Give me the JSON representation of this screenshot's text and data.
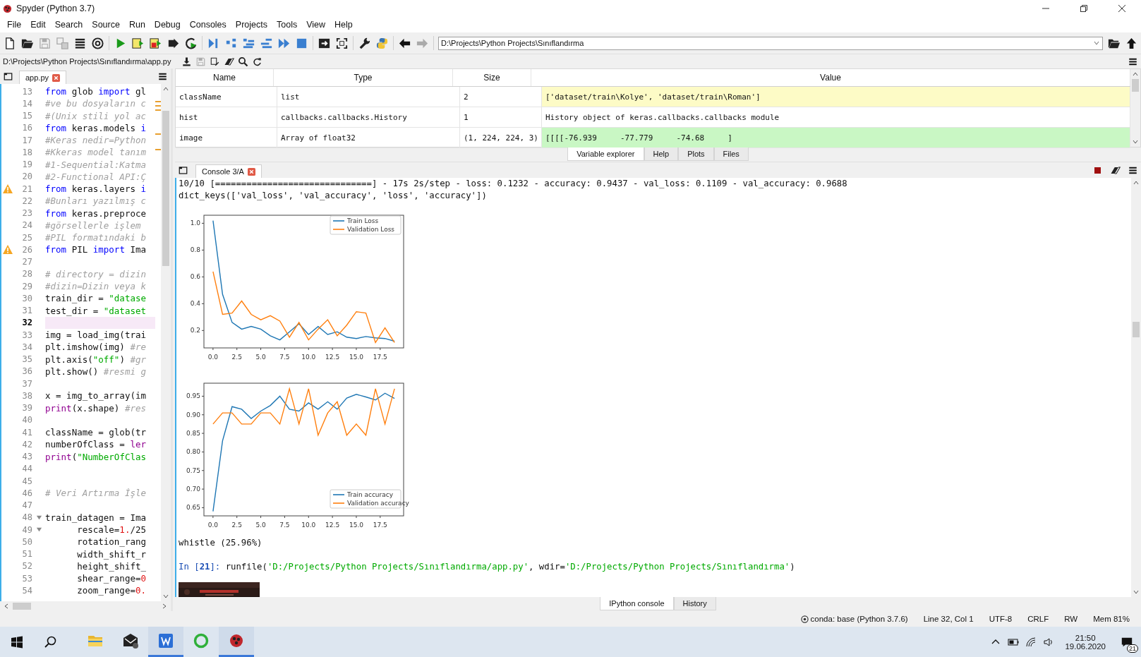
{
  "window": {
    "title": "Spyder (Python 3.7)"
  },
  "menu": [
    {
      "label": "File"
    },
    {
      "label": "Edit"
    },
    {
      "label": "Search"
    },
    {
      "label": "Source"
    },
    {
      "label": "Run"
    },
    {
      "label": "Debug"
    },
    {
      "label": "Consoles"
    },
    {
      "label": "Projects"
    },
    {
      "label": "Tools"
    },
    {
      "label": "View"
    },
    {
      "label": "Help"
    }
  ],
  "toolbar": {
    "path": "D:\\Projects\\Python Projects\\Sınıflandırma"
  },
  "editor": {
    "file_path": "D:\\Projects\\Python Projects\\Sınıflandırma\\app.py",
    "tabs": [
      {
        "label": "app.py",
        "selected": true
      }
    ],
    "lines": [
      {
        "number": "13",
        "kind": "code",
        "current": false,
        "segs": [
          {
            "kind": "kw",
            "text": "from"
          },
          {
            "kind": "plain",
            "text": " glob "
          },
          {
            "kind": "kw",
            "text": "import"
          },
          {
            "kind": "plain",
            "text": " gl"
          }
        ]
      },
      {
        "number": "14",
        "kind": "code",
        "current": false,
        "segs": [
          {
            "kind": "com",
            "text": "#ve bu dosyaların c"
          }
        ]
      },
      {
        "number": "15",
        "kind": "code",
        "current": false,
        "segs": [
          {
            "kind": "com",
            "text": "#(Unix stili yol ac"
          }
        ]
      },
      {
        "number": "16",
        "kind": "code",
        "current": false,
        "segs": [
          {
            "kind": "kw",
            "text": "from"
          },
          {
            "kind": "plain",
            "text": " keras.models "
          },
          {
            "kind": "kw",
            "text": "i"
          }
        ]
      },
      {
        "number": "17",
        "kind": "code",
        "current": false,
        "segs": [
          {
            "kind": "com",
            "text": "#Keras nedir=Python"
          }
        ]
      },
      {
        "number": "18",
        "kind": "code",
        "current": false,
        "segs": [
          {
            "kind": "com",
            "text": "#Kkeras model tanım"
          }
        ]
      },
      {
        "number": "19",
        "kind": "code",
        "current": false,
        "segs": [
          {
            "kind": "com",
            "text": "#1-Sequential:Katma"
          }
        ]
      },
      {
        "number": "20",
        "kind": "code",
        "current": false,
        "segs": [
          {
            "kind": "com",
            "text": "#2-Functional API:Ç"
          }
        ]
      },
      {
        "number": "21",
        "kind": "warning",
        "current": false,
        "segs": [
          {
            "kind": "kw",
            "text": "from"
          },
          {
            "kind": "plain",
            "text": " keras.layers "
          },
          {
            "kind": "kw",
            "text": "i"
          }
        ]
      },
      {
        "number": "22",
        "kind": "code",
        "current": false,
        "segs": [
          {
            "kind": "com",
            "text": "#Bunları yazılmış c"
          }
        ]
      },
      {
        "number": "23",
        "kind": "code",
        "current": false,
        "segs": [
          {
            "kind": "kw",
            "text": "from"
          },
          {
            "kind": "plain",
            "text": " keras.preproce"
          }
        ]
      },
      {
        "number": "24",
        "kind": "code",
        "current": false,
        "segs": [
          {
            "kind": "com",
            "text": "#görsellerle işlem"
          }
        ]
      },
      {
        "number": "25",
        "kind": "code",
        "current": false,
        "segs": [
          {
            "kind": "com",
            "text": "#PIL formatındaki b"
          }
        ]
      },
      {
        "number": "26",
        "kind": "warning",
        "current": false,
        "segs": [
          {
            "kind": "kw",
            "text": "from"
          },
          {
            "kind": "plain",
            "text": " PIL "
          },
          {
            "kind": "kw",
            "text": "import"
          },
          {
            "kind": "plain",
            "text": " Ima"
          }
        ]
      },
      {
        "number": "27",
        "kind": "code",
        "current": false
      },
      {
        "number": "28",
        "kind": "code",
        "current": false,
        "segs": [
          {
            "kind": "com",
            "text": "# directory = dizin"
          }
        ]
      },
      {
        "number": "29",
        "kind": "code",
        "current": false,
        "segs": [
          {
            "kind": "com",
            "text": "#dizin=Dizin veya k"
          }
        ]
      },
      {
        "number": "30",
        "kind": "code",
        "current": false,
        "segs": [
          {
            "kind": "plain",
            "text": "train_dir = "
          },
          {
            "kind": "str",
            "text": "\"datase"
          }
        ]
      },
      {
        "number": "31",
        "kind": "code",
        "current": false,
        "segs": [
          {
            "kind": "plain",
            "text": "test_dir = "
          },
          {
            "kind": "str",
            "text": "\"dataset"
          }
        ]
      },
      {
        "number": "32",
        "kind": "code",
        "current": true
      },
      {
        "number": "33",
        "kind": "code",
        "current": false,
        "segs": [
          {
            "kind": "plain",
            "text": "img = load_img(trai"
          }
        ]
      },
      {
        "number": "34",
        "kind": "code",
        "current": false,
        "segs": [
          {
            "kind": "plain",
            "text": "plt.imshow(img) "
          },
          {
            "kind": "com",
            "text": "#re"
          }
        ]
      },
      {
        "number": "35",
        "kind": "code",
        "current": false,
        "segs": [
          {
            "kind": "plain",
            "text": "plt.axis("
          },
          {
            "kind": "str",
            "text": "\"off\""
          },
          {
            "kind": "plain",
            "text": ") "
          },
          {
            "kind": "com",
            "text": "#gr"
          }
        ]
      },
      {
        "number": "36",
        "kind": "code",
        "current": false,
        "segs": [
          {
            "kind": "plain",
            "text": "plt.show() "
          },
          {
            "kind": "com",
            "text": "#resmi g"
          }
        ]
      },
      {
        "number": "37",
        "kind": "code",
        "current": false
      },
      {
        "number": "38",
        "kind": "code",
        "current": false,
        "segs": [
          {
            "kind": "plain",
            "text": "x = img_to_array(im"
          }
        ]
      },
      {
        "number": "39",
        "kind": "code",
        "current": false,
        "segs": [
          {
            "kind": "bi",
            "text": "print"
          },
          {
            "kind": "plain",
            "text": "(x.shape) "
          },
          {
            "kind": "com",
            "text": "#res"
          }
        ]
      },
      {
        "number": "40",
        "kind": "code",
        "current": false
      },
      {
        "number": "41",
        "kind": "code",
        "current": false,
        "segs": [
          {
            "kind": "plain",
            "text": "className = glob(tr"
          }
        ]
      },
      {
        "number": "42",
        "kind": "code",
        "current": false,
        "segs": [
          {
            "kind": "plain",
            "text": "numberOfClass = "
          },
          {
            "kind": "bi",
            "text": "ler"
          }
        ]
      },
      {
        "number": "43",
        "kind": "code",
        "current": false,
        "segs": [
          {
            "kind": "bi",
            "text": "print"
          },
          {
            "kind": "plain",
            "text": "("
          },
          {
            "kind": "str",
            "text": "\"NumberOfClas"
          }
        ]
      },
      {
        "number": "44",
        "kind": "code",
        "current": false
      },
      {
        "number": "45",
        "kind": "code",
        "current": false
      },
      {
        "number": "46",
        "kind": "code",
        "current": false,
        "segs": [
          {
            "kind": "com",
            "text": "# Veri Artırma İşle"
          }
        ]
      },
      {
        "number": "47",
        "kind": "code",
        "current": false
      },
      {
        "number": "48",
        "kind": "fold",
        "current": false,
        "segs": [
          {
            "kind": "plain",
            "text": "train_datagen = Ima"
          }
        ]
      },
      {
        "number": "49",
        "kind": "fold",
        "current": false,
        "segs": [
          {
            "kind": "plain",
            "text": "      rescale="
          },
          {
            "kind": "num",
            "text": "1."
          },
          {
            "kind": "plain",
            "text": "/25"
          }
        ]
      },
      {
        "number": "50",
        "kind": "code",
        "current": false,
        "segs": [
          {
            "kind": "plain",
            "text": "      rotation_rang"
          }
        ]
      },
      {
        "number": "51",
        "kind": "code",
        "current": false,
        "segs": [
          {
            "kind": "plain",
            "text": "      width_shift_r"
          }
        ]
      },
      {
        "number": "52",
        "kind": "code",
        "current": false,
        "segs": [
          {
            "kind": "plain",
            "text": "      height_shift_"
          }
        ]
      },
      {
        "number": "53",
        "kind": "code",
        "current": false,
        "segs": [
          {
            "kind": "plain",
            "text": "      shear_range="
          },
          {
            "kind": "num",
            "text": "0"
          }
        ]
      },
      {
        "number": "54",
        "kind": "code",
        "current": false,
        "segs": [
          {
            "kind": "plain",
            "text": "      zoom_range="
          },
          {
            "kind": "num",
            "text": "0."
          }
        ]
      }
    ]
  },
  "variable_explorer": {
    "columns": [
      "Name",
      "Type",
      "Size",
      "Value"
    ],
    "rows": [
      {
        "name": "className",
        "type": "list",
        "size": "2",
        "value": "['dataset/train\\Kolye', 'dataset/train\\Roman']",
        "color": "#fdfbc6"
      },
      {
        "name": "hist",
        "type": "callbacks.callbacks.History",
        "size": "1",
        "value": "History object of keras.callbacks.callbacks module",
        "color": "#ffffff"
      },
      {
        "name": "image",
        "type": "Array of float32",
        "size": "(1, 224, 224, 3)",
        "value": "[[[[-76.939     -77.779     -74.68     ]",
        "color": "#c9f7c4"
      }
    ],
    "tabs": [
      {
        "label": "Variable explorer",
        "selected": true
      },
      {
        "label": "Help",
        "selected": false
      },
      {
        "label": "Plots",
        "selected": false
      },
      {
        "label": "Files",
        "selected": false
      }
    ]
  },
  "console": {
    "tabs": [
      {
        "label": "Console 3/A",
        "selected": true
      }
    ],
    "outputs": [
      {
        "kind": "text",
        "text": "10/10 [==============================] - 17s 2s/step - loss: 0.1232 - accuracy: 0.9437 - val_loss: 0.1109 - val_accuracy: 0.9688"
      },
      {
        "kind": "text",
        "text": "dict_keys(['val_loss', 'val_accuracy', 'loss', 'accuracy'])"
      },
      {
        "kind": "chart",
        "chart_data": {
          "type": "line",
          "legend": "upper right",
          "x": [
            0,
            1,
            2,
            3,
            4,
            5,
            6,
            7,
            8,
            9,
            10,
            11,
            12,
            13,
            14,
            15,
            16,
            17,
            18,
            19
          ],
          "xlim": [
            -0.95,
            19.95
          ],
          "ylim": [
            0.07,
            1.06
          ],
          "xticks": [
            {
              "value": 0,
              "label": "0.0"
            },
            {
              "value": 2.5,
              "label": "2.5"
            },
            {
              "value": 5,
              "label": "5.0"
            },
            {
              "value": 7.5,
              "label": "7.5"
            },
            {
              "value": 10,
              "label": "10.0"
            },
            {
              "value": 12.5,
              "label": "12.5"
            },
            {
              "value": 15,
              "label": "15.0"
            },
            {
              "value": 17.5,
              "label": "17.5"
            }
          ],
          "yticks": [
            {
              "value": 0.2,
              "label": "0.2"
            },
            {
              "value": 0.4,
              "label": "0.4"
            },
            {
              "value": 0.6,
              "label": "0.6"
            },
            {
              "value": 0.8,
              "label": "0.8"
            },
            {
              "value": 1.0,
              "label": "1.0"
            }
          ],
          "series": [
            {
              "name": "Train Loss",
              "color": "#1f77b4",
              "values": [
                1.02,
                0.47,
                0.26,
                0.21,
                0.23,
                0.21,
                0.16,
                0.13,
                0.19,
                0.25,
                0.17,
                0.23,
                0.17,
                0.19,
                0.15,
                0.14,
                0.155,
                0.145,
                0.14,
                0.12
              ]
            },
            {
              "name": "Validation Loss",
              "color": "#ff7f0e",
              "values": [
                0.64,
                0.32,
                0.33,
                0.42,
                0.32,
                0.28,
                0.31,
                0.27,
                0.15,
                0.26,
                0.13,
                0.21,
                0.28,
                0.16,
                0.24,
                0.34,
                0.33,
                0.11,
                0.22,
                0.11
              ]
            }
          ]
        }
      },
      {
        "kind": "chart",
        "chart_data": {
          "type": "line",
          "legend": "lower right",
          "x": [
            0,
            1,
            2,
            3,
            4,
            5,
            6,
            7,
            8,
            9,
            10,
            11,
            12,
            13,
            14,
            15,
            16,
            17,
            18,
            19
          ],
          "xlim": [
            -0.95,
            19.95
          ],
          "ylim": [
            0.628,
            0.985
          ],
          "xticks": [
            {
              "value": 0,
              "label": "0.0"
            },
            {
              "value": 2.5,
              "label": "2.5"
            },
            {
              "value": 5,
              "label": "5.0"
            },
            {
              "value": 7.5,
              "label": "7.5"
            },
            {
              "value": 10,
              "label": "10.0"
            },
            {
              "value": 12.5,
              "label": "12.5"
            },
            {
              "value": 15,
              "label": "15.0"
            },
            {
              "value": 17.5,
              "label": "17.5"
            }
          ],
          "yticks": [
            {
              "value": 0.65,
              "label": "0.65"
            },
            {
              "value": 0.7,
              "label": "0.70"
            },
            {
              "value": 0.75,
              "label": "0.75"
            },
            {
              "value": 0.8,
              "label": "0.80"
            },
            {
              "value": 0.85,
              "label": "0.85"
            },
            {
              "value": 0.9,
              "label": "0.90"
            },
            {
              "value": 0.95,
              "label": "0.95"
            }
          ],
          "series": [
            {
              "name": "Train accuracy",
              "color": "#1f77b4",
              "values": [
                0.64,
                0.83,
                0.922,
                0.915,
                0.89,
                0.91,
                0.925,
                0.95,
                0.915,
                0.91,
                0.932,
                0.915,
                0.935,
                0.915,
                0.945,
                0.955,
                0.948,
                0.94,
                0.958,
                0.944
              ]
            },
            {
              "name": "Validation accuracy",
              "color": "#ff7f0e",
              "values": [
                0.875,
                0.905,
                0.905,
                0.875,
                0.875,
                0.905,
                0.905,
                0.875,
                0.97,
                0.875,
                0.97,
                0.845,
                0.905,
                0.935,
                0.845,
                0.875,
                0.845,
                0.97,
                0.875,
                0.97
              ]
            }
          ]
        }
      },
      {
        "kind": "text",
        "text": "whistle (25.96%)"
      },
      {
        "kind": "input",
        "segs": [
          {
            "kind": "prompt",
            "text": "In ["
          },
          {
            "kind": "promptnum",
            "text": "21"
          },
          {
            "kind": "prompt",
            "text": "]: "
          },
          {
            "kind": "plain",
            "text": "runfile("
          },
          {
            "kind": "str",
            "text": "'D:/Projects/Python Projects/Sınıflandırma/app.py'"
          },
          {
            "kind": "plain",
            "text": ", wdir="
          },
          {
            "kind": "str",
            "text": "'D:/Projects/Python Projects/Sınıflandırma'"
          },
          {
            "kind": "plain",
            "text": ")"
          }
        ]
      },
      {
        "kind": "picture"
      }
    ],
    "bottom_tabs": [
      {
        "label": "IPython console",
        "selected": true
      },
      {
        "label": "History",
        "selected": false
      }
    ]
  },
  "status_bar": {
    "env": "conda: base (Python 3.7.6)",
    "position": "Line 32, Col 1",
    "encoding": "UTF-8",
    "eol": "CRLF",
    "mode": "RW",
    "memory": "Mem 81%"
  },
  "taskbar": {
    "apps": [
      {
        "kind": "explorer",
        "running": false
      },
      {
        "kind": "mail",
        "running": false
      },
      {
        "kind": "writer",
        "running": true
      },
      {
        "kind": "ring",
        "running": false
      },
      {
        "kind": "spyder",
        "running": true
      }
    ],
    "time": "21:50",
    "date": "19.06.2020",
    "notifications": "21"
  }
}
